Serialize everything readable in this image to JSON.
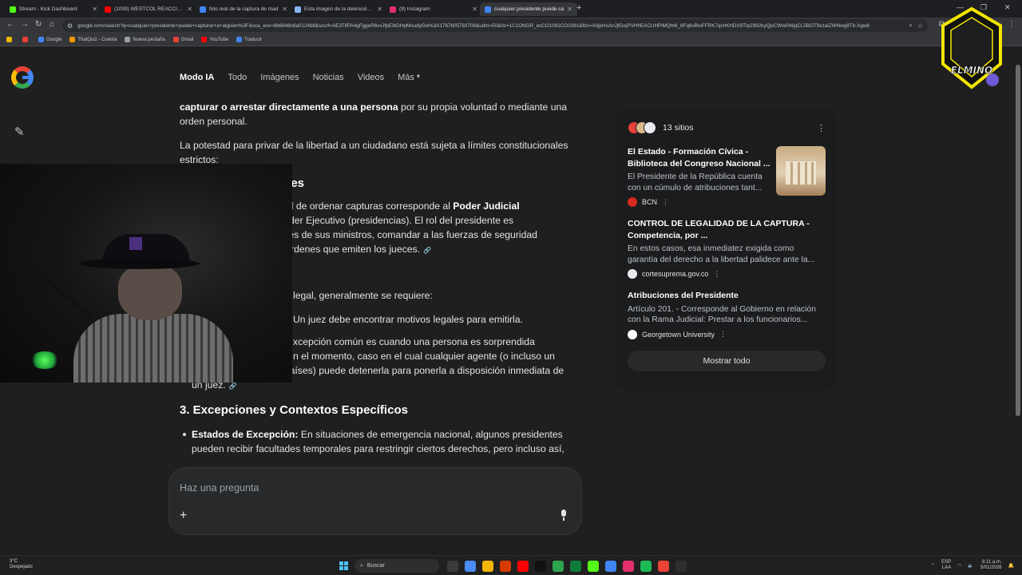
{
  "browser": {
    "tabs": [
      {
        "title": "Stream - Kick Dashboard",
        "color": "#53fc18",
        "active": false
      },
      {
        "title": "(1039) WESTCOL REACCIONA A",
        "color": "#ff0000",
        "active": false
      },
      {
        "title": "foto real de la captura de mad",
        "color": "#4285f4",
        "active": false
      },
      {
        "title": "Esta imagen de la detención d",
        "color": "#8ab4f8",
        "active": false
      },
      {
        "title": "(9) Instagram",
        "color": "#e1306c",
        "active": false
      },
      {
        "title": "cualquier presidente puede ca",
        "color": "#4285f4",
        "active": true
      }
    ],
    "url": "google.com/search?q=cualquier+presidente+puede+capturar+a+alguien%3F&sca_esv=8b6848c6a0124b8&sxsrf=AE3TifPA4gFggeR6vxJfpEIbDHpMoudyGw%3A1767605783708&udm=50&rlz=1C1ONGR_esCO1091CO1091&fbs=AIIjpHxAnJjfGojPVHhEACUHPiMQht6_8Fq6vBIoFFRK7qchKHDX9TIp2992kyQjsCWw0WjqCL5BOT9xzaIZWNwg8Tb-Xgw8",
    "bookmarks": [
      {
        "label": "",
        "color": "#f2b705"
      },
      {
        "label": "",
        "color": "#ea4335"
      },
      {
        "label": "Google",
        "color": "#4285f4"
      },
      {
        "label": "ThatQuiz - Cuenta",
        "color": "#f29900"
      },
      {
        "label": "Nueva pestaña",
        "color": "#9aa0a6"
      },
      {
        "label": "Gmail",
        "color": "#ea4335"
      },
      {
        "label": "YouTube",
        "color": "#ff0000"
      },
      {
        "label": "Traducir",
        "color": "#4285f4"
      }
    ]
  },
  "nav": {
    "items": [
      "Modo IA",
      "Todo",
      "Imágenes",
      "Noticias",
      "Videos",
      "Más"
    ],
    "active": "Modo IA"
  },
  "answer": {
    "p1_bold": "capturar o arrestar directamente a una persona",
    "p1_rest": " por su propia voluntad o mediante una orden personal.",
    "p2": "La potestad para privar de la libertad a un ciudadano está sujeta a límites constitucionales estrictos:",
    "h_partial": "deres",
    "p3_a": "ultad de ordenar capturas corresponde al ",
    "p3_bold": "Poder Judicial",
    "p3_b": "l Poder Ejecutivo (presidencias). El rol del presidente es",
    "p3_c": "través de sus ministros, comandar a las fuerzas de seguridad",
    "p3_d": "as órdenes que emiten los jueces.",
    "p4": "legal, generalmente se requiere:",
    "p5": "Un juez debe encontrar motivos legales para emitirla.",
    "p6_a": "xcepción común es cuando una persona es sorprendida",
    "p6_b": "n el momento, caso en el cual cualquier agente (o incluso un",
    "p6_c": "ciudadano en ciertos países) puede detenerla para ponerla a disposición inmediata de un juez.",
    "h3": "3. Excepciones y Contextos Específicos",
    "li_bold": "Estados de Excepción:",
    "li_rest": " En situaciones de emergencia nacional, algunos presidentes pueden recibir facultades temporales para restringir ciertos derechos, pero incluso así,"
  },
  "sources": {
    "count_label": "13 sitios",
    "avatar_colors": [
      "#e8413a",
      "#d9b98c",
      "#e8eaed"
    ],
    "items": [
      {
        "title": "El Estado - Formación Cívica - Biblioteca del Congreso Nacional ...",
        "snippet": "El Presidente de la República cuenta con un cúmulo de atribuciones tant...",
        "site": "BCN",
        "favicon_color": "#d52b1e",
        "has_thumb": true
      },
      {
        "title": "CONTROL DE LEGALIDAD DE LA CAPTURA - Competencia, por ...",
        "snippet": "En estos casos, esa inmediatez exigida como garantía del derecho a la libertad palidece ante la...",
        "site": "cortesuprema.gov.co",
        "favicon_color": "#e8eaed",
        "has_thumb": false
      },
      {
        "title": "Atribuciones del Presidente",
        "snippet": "Artículo 201. - Corresponde al Gobierno en relación con la Rama Judicial: Prestar a los funcionarios...",
        "site": "Georgetown University",
        "favicon_color": "#ffffff",
        "has_thumb": false
      }
    ],
    "show_all": "Mostrar todo"
  },
  "prompt": {
    "placeholder": "Haz una pregunta"
  },
  "taskbar": {
    "weather_temp": "3°C",
    "weather_desc": "Despejado",
    "search_label": "Buscar",
    "lang": "ESP",
    "lang2": "LAA",
    "time": "8:11 a.m.",
    "date": "5/01/2026",
    "app_colors": [
      "#3a3a3a",
      "#4b8bf4",
      "#f2b705",
      "#d83b01",
      "#ff0000",
      "#111111",
      "#2ea44f",
      "#0f7b3b",
      "#53fc18",
      "#4285f4",
      "#e1306c",
      "#1db954",
      "#ea4335",
      "#2f2f2f"
    ]
  },
  "overlay": {
    "badge_text": "ELMINO"
  }
}
